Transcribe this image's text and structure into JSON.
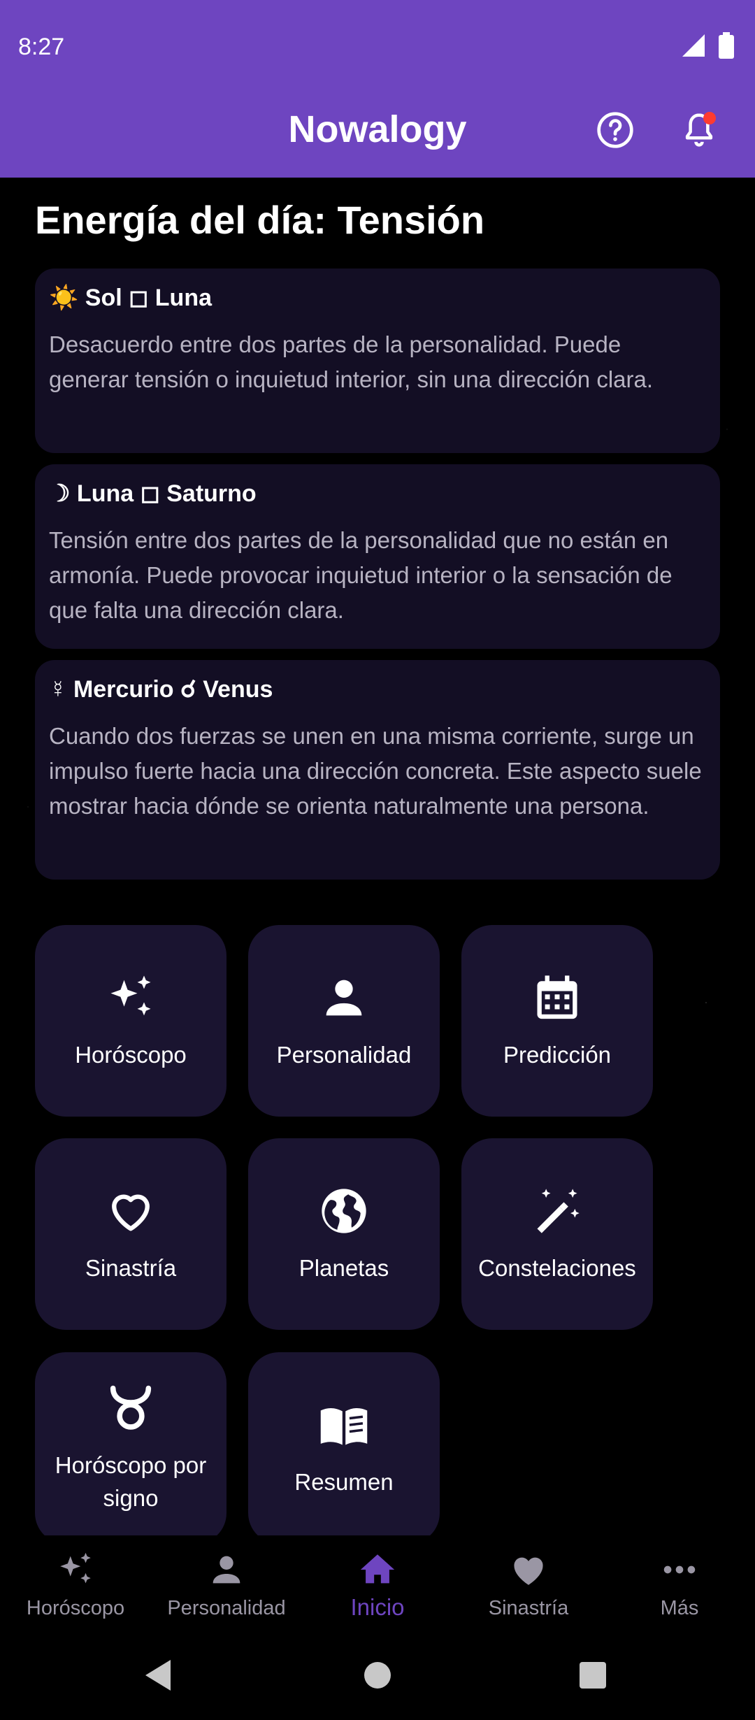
{
  "status": {
    "time": "8:27"
  },
  "app": {
    "title": "Nowalogy"
  },
  "energy": {
    "title": "Energía del día: Tensión",
    "aspects": [
      {
        "title": "☀️ Sol ◻ Luna",
        "text": "Desacuerdo entre dos partes de la personalidad. Puede generar tensión o inquietud interior, sin una dirección clara."
      },
      {
        "title": "☽ Luna ◻ Saturno",
        "text": "Tensión entre dos partes de la personalidad que no están en armonía. Puede provocar inquietud interior o la sensación de que falta una dirección clara."
      },
      {
        "title": "☿ Mercurio ☌ Venus",
        "text": "Cuando dos fuerzas se unen en una misma corriente, surge un impulso fuerte hacia una dirección concreta. Este aspecto suele mostrar hacia dónde se orienta naturalmente una persona."
      }
    ]
  },
  "tiles": [
    {
      "label": "Horóscopo",
      "icon": "sparkles-icon"
    },
    {
      "label": "Personalidad",
      "icon": "person-icon"
    },
    {
      "label": "Predicción",
      "icon": "calendar-icon"
    },
    {
      "label": "Sinastría",
      "icon": "heart-outline-icon"
    },
    {
      "label": "Planetas",
      "icon": "globe-icon"
    },
    {
      "label": "Constelaciones",
      "icon": "magic-wand-icon"
    },
    {
      "label": "Horóscopo por signo",
      "icon": "taurus-icon"
    },
    {
      "label": "Resumen",
      "icon": "book-icon"
    }
  ],
  "nav": [
    {
      "label": "Horóscopo",
      "icon": "sparkles-icon"
    },
    {
      "label": "Personalidad",
      "icon": "person-icon"
    },
    {
      "label": "Inicio",
      "icon": "home-icon",
      "active": true
    },
    {
      "label": "Sinastría",
      "icon": "heart-icon"
    },
    {
      "label": "Más",
      "icon": "more-icon"
    }
  ],
  "colors": {
    "primary": "#6e45c0",
    "card": "#130e24",
    "tile": "#1a1430",
    "badge": "#ff3b30"
  }
}
